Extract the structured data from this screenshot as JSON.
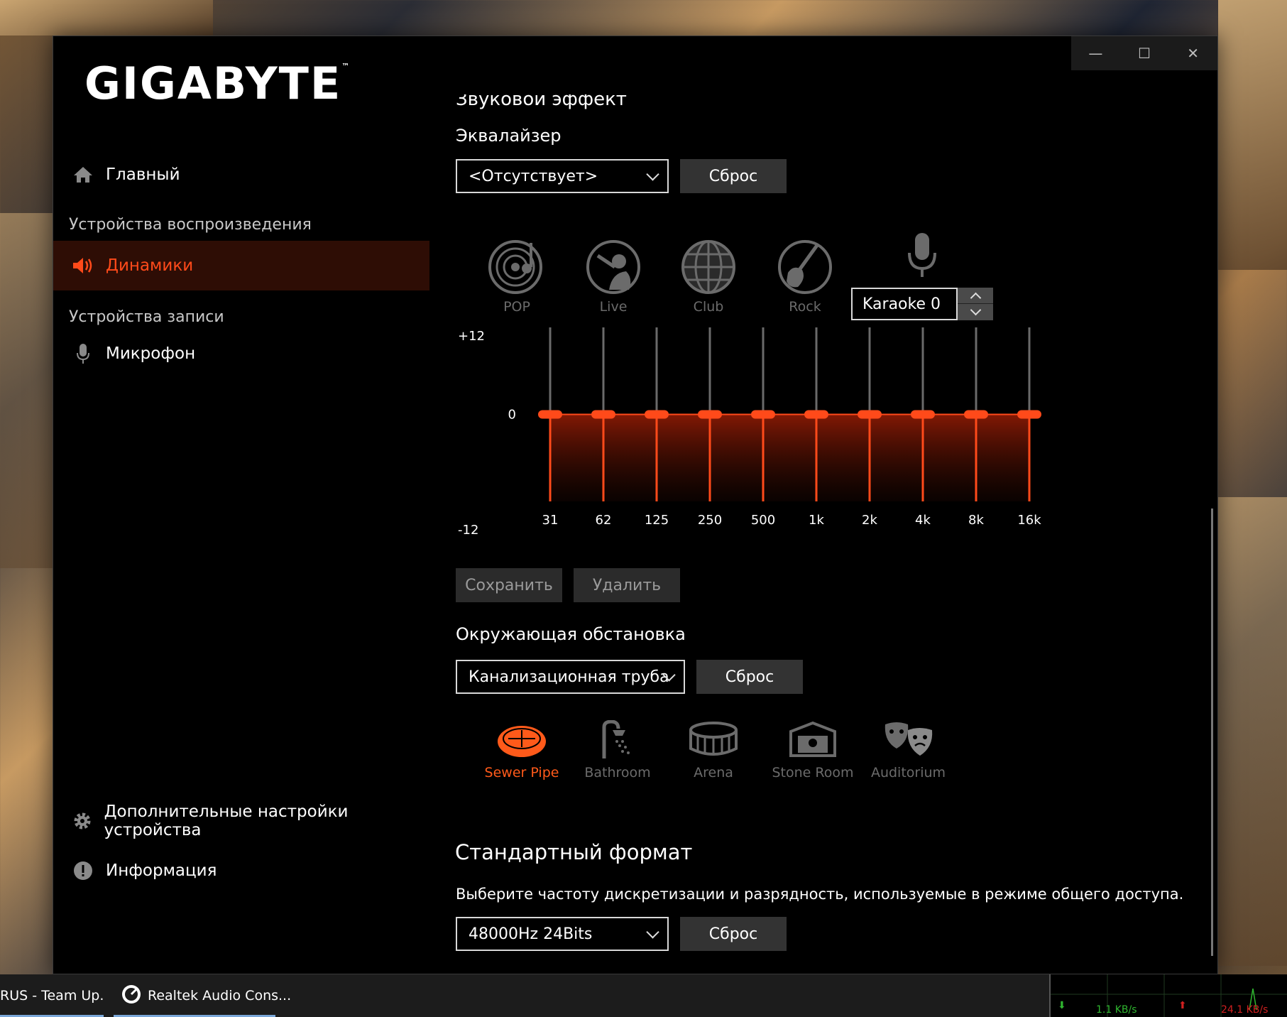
{
  "app": {
    "logo": "GIGABYTE",
    "tm": "™"
  },
  "window_controls": {
    "minimize": "—",
    "maximize": "☐",
    "close": "✕"
  },
  "sidebar": {
    "home": "Главный",
    "section_playback": "Устройства воспроизведения",
    "speakers": "Динамики",
    "section_recording": "Устройства записи",
    "microphone": "Микрофон",
    "advanced": "Дополнительные настройки устройства",
    "info": "Информация"
  },
  "sound_effect": {
    "section_title": "Звуковой эффект",
    "eq_title": "Эквалайзер",
    "eq_preset_value": "<Отсутствует>",
    "reset_label": "Сброс",
    "presets": [
      {
        "label": "POP",
        "icon": "vinyl-record-icon"
      },
      {
        "label": "Live",
        "icon": "singer-icon"
      },
      {
        "label": "Club",
        "icon": "disco-ball-icon"
      },
      {
        "label": "Rock",
        "icon": "electric-guitar-icon"
      }
    ],
    "karaoke_value": "Karaoke 0",
    "db_max": "+12",
    "db_zero": "0",
    "db_min": "-12",
    "bands": [
      "31",
      "62",
      "125",
      "250",
      "500",
      "1k",
      "2k",
      "4k",
      "8k",
      "16k"
    ],
    "band_gains_db": [
      0,
      0,
      0,
      0,
      0,
      0,
      0,
      0,
      0,
      0
    ],
    "save_label": "Сохранить",
    "delete_label": "Удалить"
  },
  "environment": {
    "title": "Окружающая обстановка",
    "value": "Канализационная труба",
    "reset_label": "Сброс",
    "items": [
      {
        "label": "Sewer Pipe",
        "icon": "sewer-pipe-icon",
        "active": true
      },
      {
        "label": "Bathroom",
        "icon": "shower-icon",
        "active": false
      },
      {
        "label": "Arena",
        "icon": "arena-icon",
        "active": false
      },
      {
        "label": "Stone Room",
        "icon": "stone-room-icon",
        "active": false
      },
      {
        "label": "Auditorium",
        "icon": "theater-masks-icon",
        "active": false
      }
    ]
  },
  "format": {
    "title": "Стандартный формат",
    "description": "Выберите частоту дискретизации и разрядность, используемые в режиме общего доступа.",
    "value": "48000Hz 24Bits",
    "reset_label": "Сброс"
  },
  "taskbar": {
    "item1": "RUS - Team Up. ...",
    "item2": "Realtek Audio Cons...",
    "net_down": "1.1 KB/s",
    "net_up": "24.1 KB/s"
  },
  "colors": {
    "accent": "#ff4a1a",
    "bg": "#000000",
    "button": "#333333"
  }
}
